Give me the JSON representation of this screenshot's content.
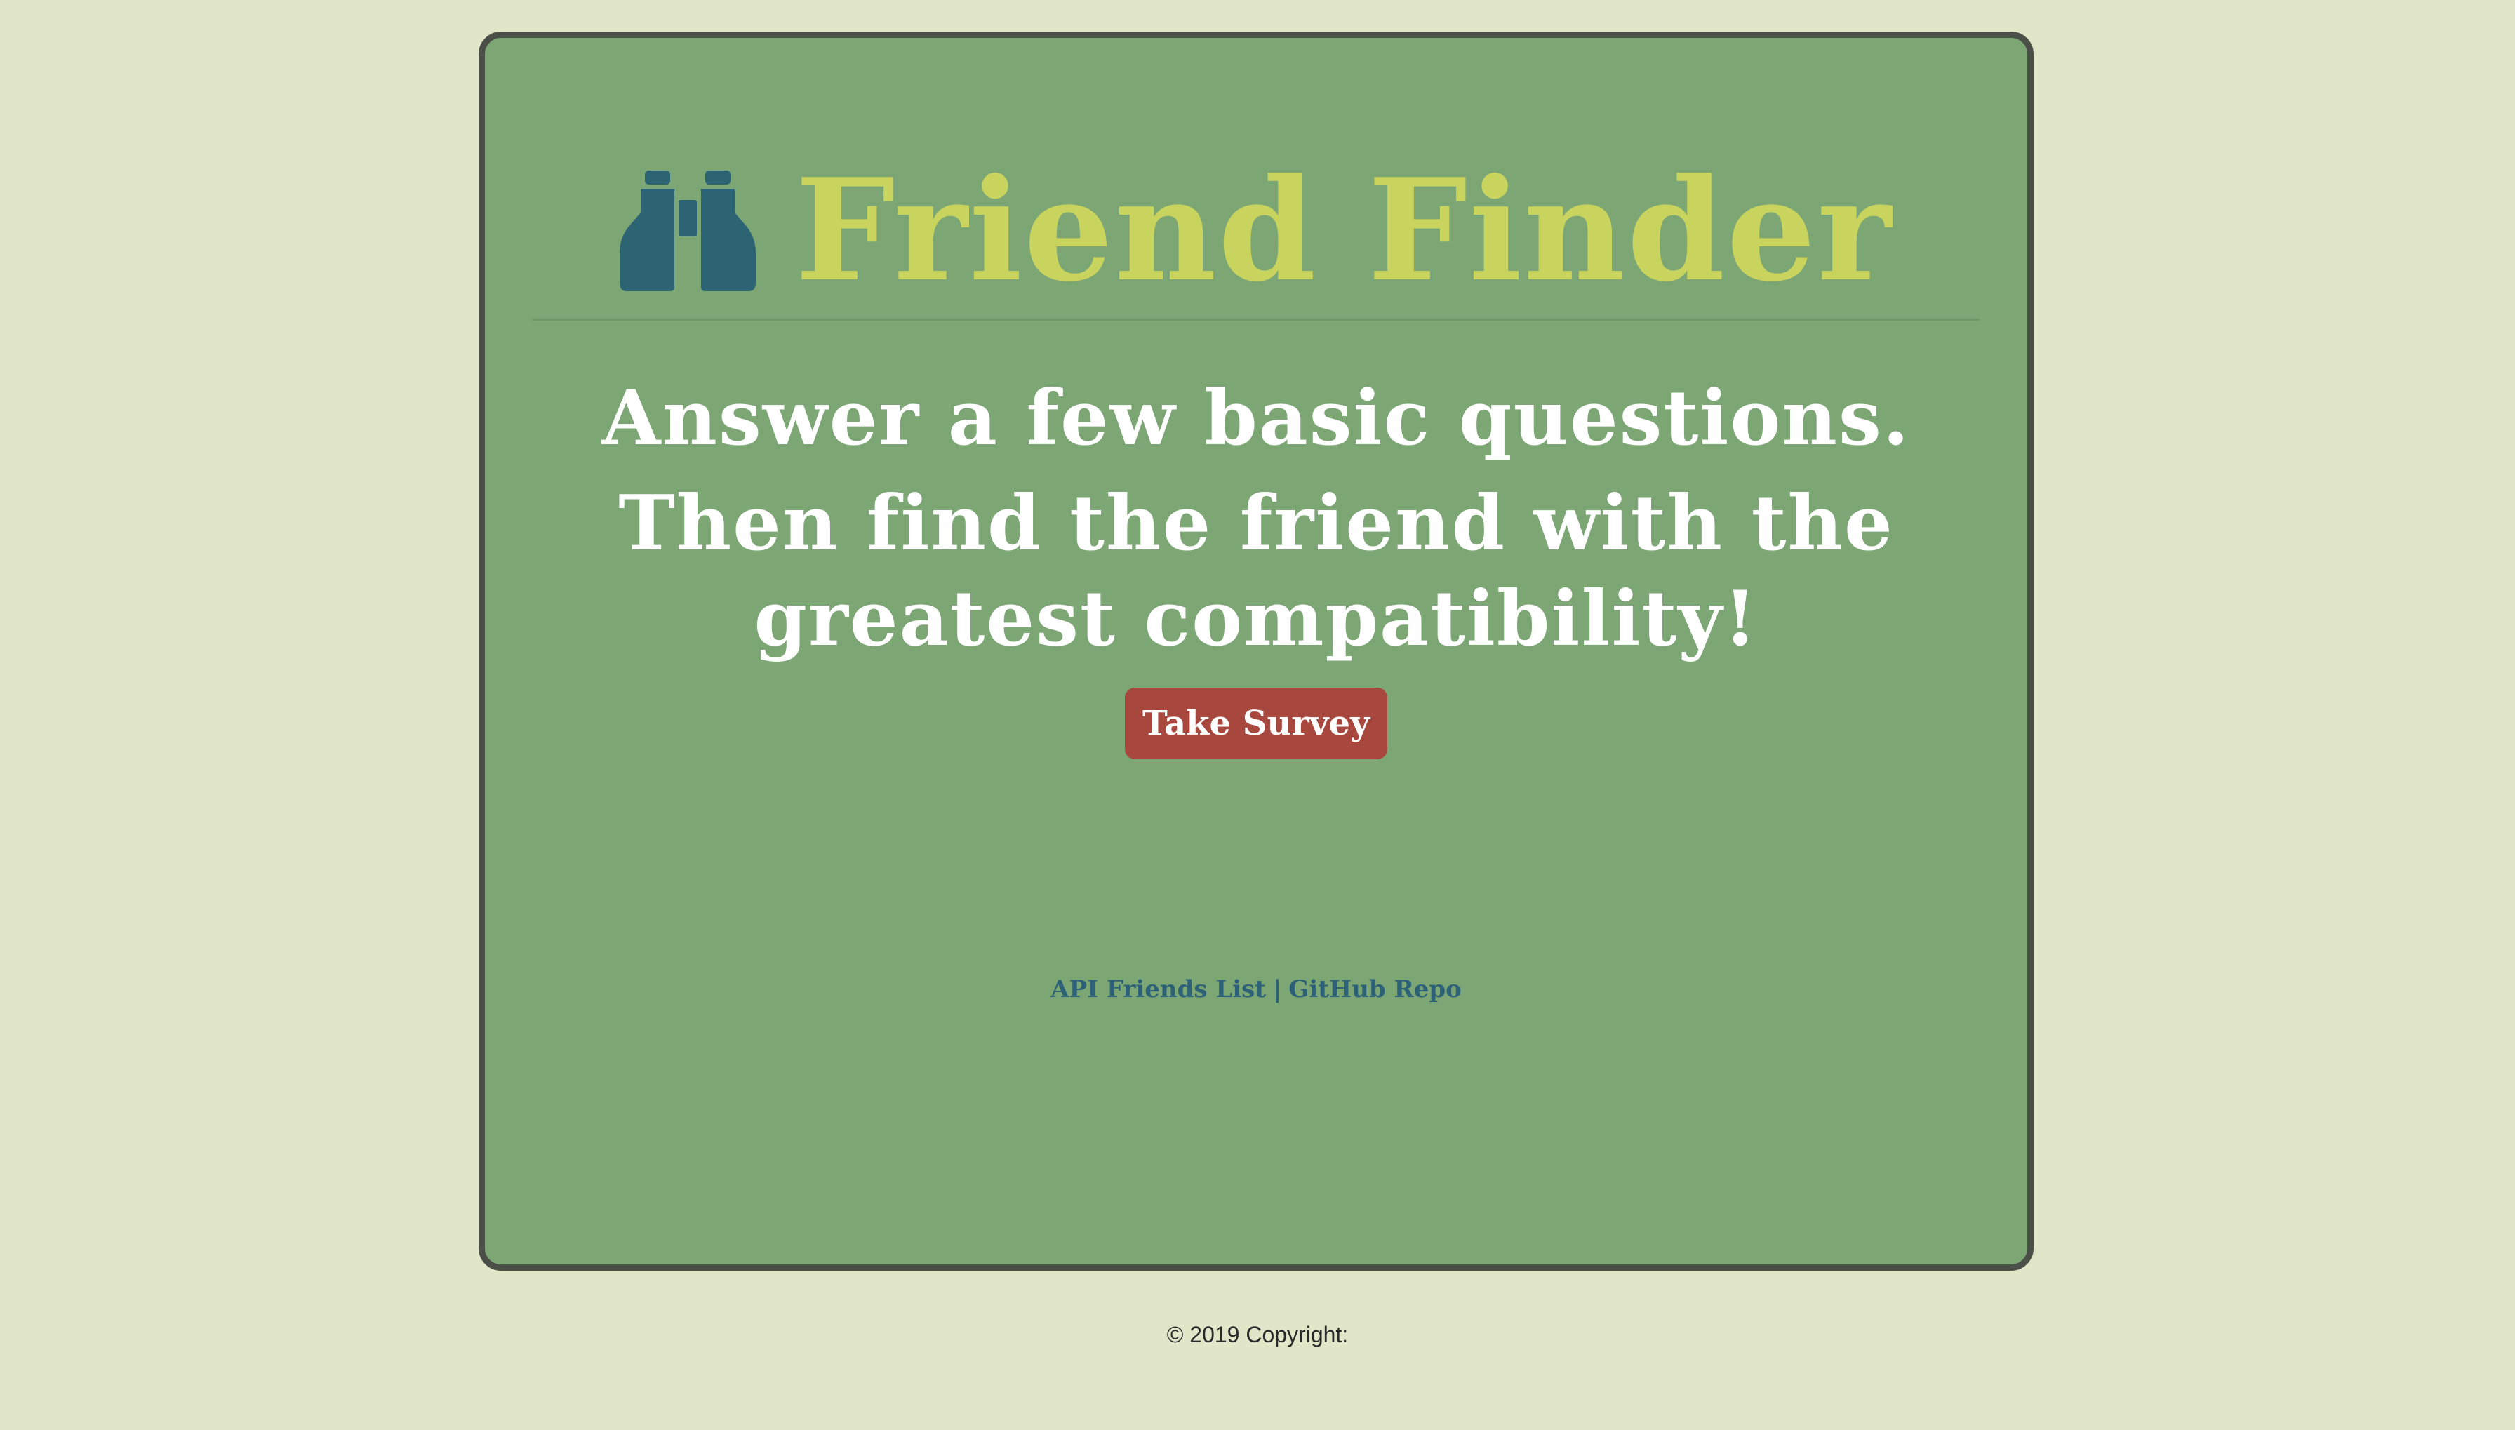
{
  "header": {
    "icon": "binoculars-icon",
    "title": "Friend Finder",
    "title_color": "#c8d45d",
    "icon_color": "#2d6474"
  },
  "main": {
    "lead_line1": "Answer a few basic questions.",
    "lead_line2": "Then find the friend with the greatest compatibility!",
    "button_label": "Take Survey",
    "button_color": "#a7473e"
  },
  "links": {
    "api_friends": "API Friends List",
    "separator": "|",
    "github": "GitHub Repo"
  },
  "footer": {
    "copyright": "© 2019 Copyright:"
  },
  "colors": {
    "page_background": "#e1e6c9",
    "card_background": "#7da675",
    "card_border": "#4a4f48"
  }
}
